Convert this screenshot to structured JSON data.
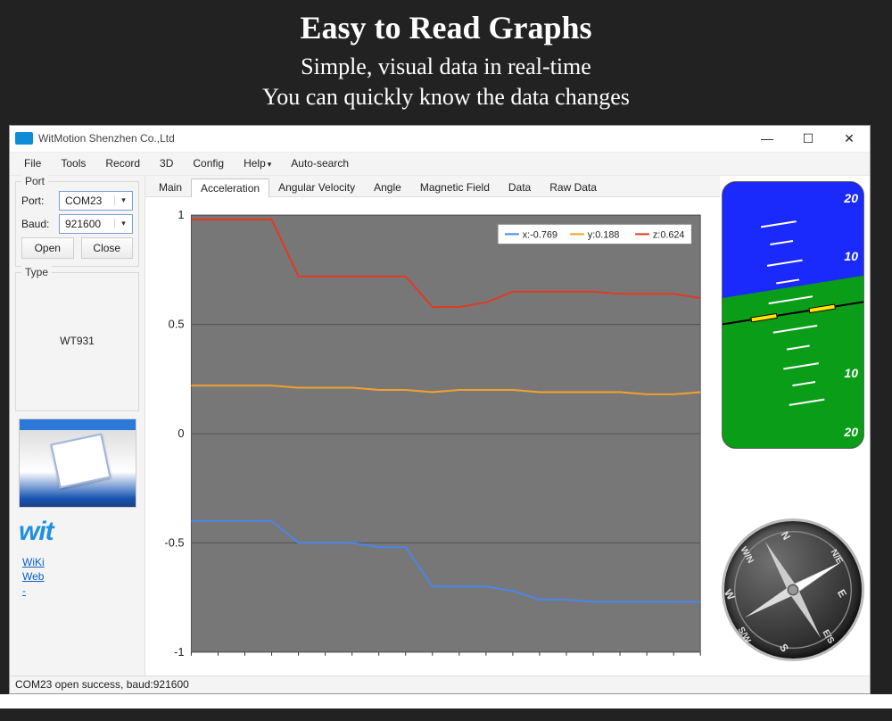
{
  "promo": {
    "heading": "Easy to Read Graphs",
    "line1": "Simple, visual data in real-time",
    "line2": "You can quickly know the data changes"
  },
  "window": {
    "title": "WitMotion Shenzhen Co.,Ltd"
  },
  "menu": {
    "file": "File",
    "tools": "Tools",
    "record": "Record",
    "threeD": "3D",
    "config": "Config",
    "help": "Help",
    "autosearch": "Auto-search"
  },
  "sidebar": {
    "port_group": "Port",
    "port_label": "Port:",
    "port_value": "COM23",
    "baud_label": "Baud:",
    "baud_value": "921600",
    "open": "Open",
    "close": "Close",
    "type_group": "Type",
    "type_value": "WT931",
    "links": {
      "wiki": "WiKi",
      "web": "Web",
      "dash": "-"
    }
  },
  "tabs": {
    "main": "Main",
    "acceleration": "Acceleration",
    "angular_velocity": "Angular Velocity",
    "angle": "Angle",
    "magnetic_field": "Magnetic Field",
    "data": "Data",
    "raw_data": "Raw Data"
  },
  "legend": {
    "x": "x:-0.769",
    "y": "y:0.188",
    "z": "z:0.624"
  },
  "adi": {
    "t20": "20",
    "t10": "10",
    "b10": "10",
    "b20": "20"
  },
  "compass": {
    "n": "N",
    "ne": "N/E",
    "e": "E",
    "es": "E/S",
    "s": "S",
    "sw": "S/W",
    "w": "W",
    "wn": "W/N"
  },
  "status": "COM23 open success, baud:921600",
  "chart_data": {
    "type": "line",
    "title": "",
    "xlabel": "",
    "ylabel": "",
    "ylim": [
      -1,
      1
    ],
    "x": [
      0,
      1,
      2,
      3,
      4,
      5,
      6,
      7,
      8,
      9,
      10,
      11,
      12,
      13,
      14,
      15,
      16,
      17,
      18,
      19
    ],
    "series": [
      {
        "name": "x:-0.769",
        "color": "#4a86e8",
        "values": [
          -0.4,
          -0.4,
          -0.4,
          -0.4,
          -0.5,
          -0.5,
          -0.5,
          -0.52,
          -0.52,
          -0.7,
          -0.7,
          -0.7,
          -0.72,
          -0.76,
          -0.76,
          -0.77,
          -0.77,
          -0.77,
          -0.77,
          -0.77
        ]
      },
      {
        "name": "y:0.188",
        "color": "#f0a030",
        "values": [
          0.22,
          0.22,
          0.22,
          0.22,
          0.21,
          0.21,
          0.21,
          0.2,
          0.2,
          0.19,
          0.2,
          0.2,
          0.2,
          0.19,
          0.19,
          0.19,
          0.19,
          0.18,
          0.18,
          0.19
        ]
      },
      {
        "name": "z:0.624",
        "color": "#e03a22",
        "values": [
          0.98,
          0.98,
          0.98,
          0.98,
          0.72,
          0.72,
          0.72,
          0.72,
          0.72,
          0.58,
          0.58,
          0.6,
          0.65,
          0.65,
          0.65,
          0.65,
          0.64,
          0.64,
          0.64,
          0.62
        ]
      }
    ]
  }
}
